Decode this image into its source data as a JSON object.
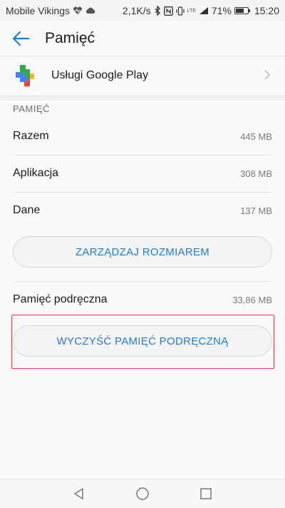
{
  "status_bar": {
    "carrier": "Mobile Vikings",
    "speed": "2,1K/s",
    "network": "LTE",
    "battery": "71%",
    "battery_level": 0.71,
    "time": "15:20"
  },
  "app_bar": {
    "title": "Pamięć",
    "back_icon": "arrow-left-icon"
  },
  "app_info": {
    "name": "Usługi Google Play",
    "icon": "google-play-services-icon"
  },
  "storage": {
    "section_title": "PAMIĘĆ",
    "rows": [
      {
        "label": "Razem",
        "value": "445 MB"
      },
      {
        "label": "Aplikacja",
        "value": "308 MB"
      },
      {
        "label": "Dane",
        "value": "137 MB"
      }
    ],
    "manage_button": "ZARZĄDZAJ ROZMIAREM"
  },
  "cache": {
    "label": "Pamięć podręczna",
    "value": "33,86 MB",
    "clear_button": "WYCZYŚĆ PAMIĘĆ PODRĘCZNĄ"
  },
  "colors": {
    "accent": "#1e7dd6",
    "highlight": "#e23c3c"
  }
}
